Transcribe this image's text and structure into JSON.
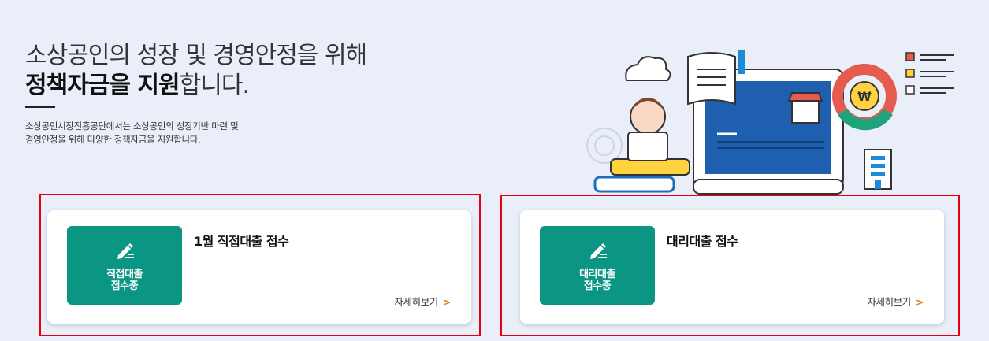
{
  "hero": {
    "title_line1": "소상공인의 성장 및 경영안정을 위해",
    "title_bold": "정책자금을 지원",
    "title_rest": "합니다.",
    "desc_line1": "소상공인시장진흥공단에서는 소상공인의 성장기반 마련 및",
    "desc_line2": "경영안정을 위해 다양한 정책자금을 지원합니다."
  },
  "colors": {
    "accent_green": "#0a9682",
    "highlight_red": "#e60012",
    "link_chevron": "#e07b00",
    "background": "#e9eef8"
  },
  "cards": [
    {
      "badge_icon": "pencil-write-icon",
      "badge_line1": "직접대출",
      "badge_line2": "접수중",
      "title": "1월 직접대출 접수",
      "link_label": "자세히보기"
    },
    {
      "badge_icon": "pencil-write-icon",
      "badge_line1": "대리대출",
      "badge_line2": "접수중",
      "title": "대리대출 접수",
      "link_label": "자세히보기"
    }
  ]
}
